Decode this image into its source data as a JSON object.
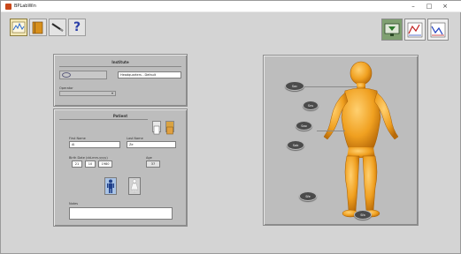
{
  "window": {
    "title": "BPLabWin",
    "minimize": "–",
    "maximize": "□",
    "close": "×"
  },
  "toolbar": {
    "buttons": [
      "chart-wave-icon",
      "book-icon",
      "pen-icon",
      "help-icon"
    ],
    "help_label": "?"
  },
  "right_tools": [
    "green-monitor-icon",
    "red-chart-icon",
    "blue-chart-icon"
  ],
  "institute": {
    "title": "Institute",
    "logo_text": "",
    "name_value": "Headquarters - Default",
    "operator_label": "Operator",
    "operator_value": ""
  },
  "patient": {
    "title": "Patient",
    "first_name_label": "First Name",
    "first_name_value": "Al",
    "last_name_label": "Last Name",
    "last_name_value": "Ze",
    "birth_label": "Birth Date (dd-mm-yyyy)",
    "birth_day": "21",
    "birth_month": "10",
    "birth_year": "1980",
    "age_label": "Age",
    "age_value": "37",
    "notes_label": "Notes",
    "notes_value": "",
    "selected_gender": "male"
  },
  "body_map": {
    "buttons": [
      {
        "key": "head",
        "label": "Sac"
      },
      {
        "key": "chest",
        "label": "Sns"
      },
      {
        "key": "arm",
        "label": "Sao"
      },
      {
        "key": "abdomen",
        "label": "Sab"
      },
      {
        "key": "thigh",
        "label": "Sfe"
      },
      {
        "key": "foot",
        "label": "Sfa"
      }
    ],
    "figure_color": "#f0a020"
  },
  "colors": {
    "background": "#d4d4d4",
    "panel": "#bdbdbd",
    "figure": "#f0a020"
  }
}
